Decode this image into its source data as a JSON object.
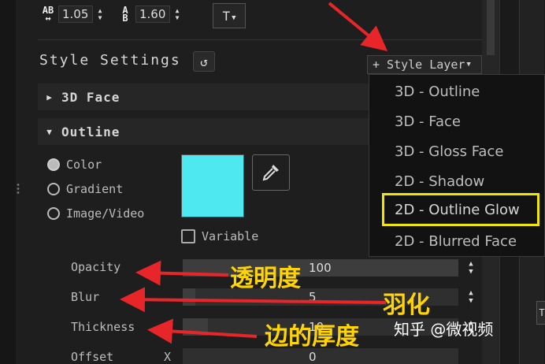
{
  "toolbar": {
    "char_spacing_icon": "character-spacing-icon",
    "char_spacing_value": "1.05",
    "line_spacing_icon": "line-spacing-icon",
    "line_spacing_value": "1.60",
    "text_style_label": "T"
  },
  "style_settings": {
    "title": "Style Settings",
    "style_layer_label": "+ Style Layer",
    "sections": [
      {
        "label": "3D Face",
        "expanded": false
      },
      {
        "label": "Outline",
        "expanded": true
      }
    ],
    "fill_options": [
      {
        "label": "Color",
        "selected": true
      },
      {
        "label": "Gradient",
        "selected": false
      },
      {
        "label": "Image/Video",
        "selected": false
      }
    ],
    "swatch_color": "#4ee8f0",
    "variable_label": "Variable",
    "properties": [
      {
        "label": "Opacity",
        "value": "100"
      },
      {
        "label": "Blur",
        "value": "5"
      },
      {
        "label": "Thickness",
        "value": "10"
      },
      {
        "label": "Offset",
        "value": "0"
      }
    ],
    "offset_axis": "X"
  },
  "style_layer_menu": {
    "items": [
      {
        "label": "3D - Outline"
      },
      {
        "label": "3D - Face"
      },
      {
        "label": "3D - Gloss Face"
      },
      {
        "label": "2D - Shadow"
      },
      {
        "label": "2D - Outline Glow"
      },
      {
        "label": "2D - Blurred Face"
      }
    ]
  },
  "annotations": {
    "opacity_note": "透明度",
    "blur_note": "羽化",
    "thickness_note": "边的厚度",
    "accent_color": "#ffd400",
    "arrow_color": "#e8262a",
    "highlight_color": "#f2e600"
  },
  "watermark": "知乎 @微视频"
}
